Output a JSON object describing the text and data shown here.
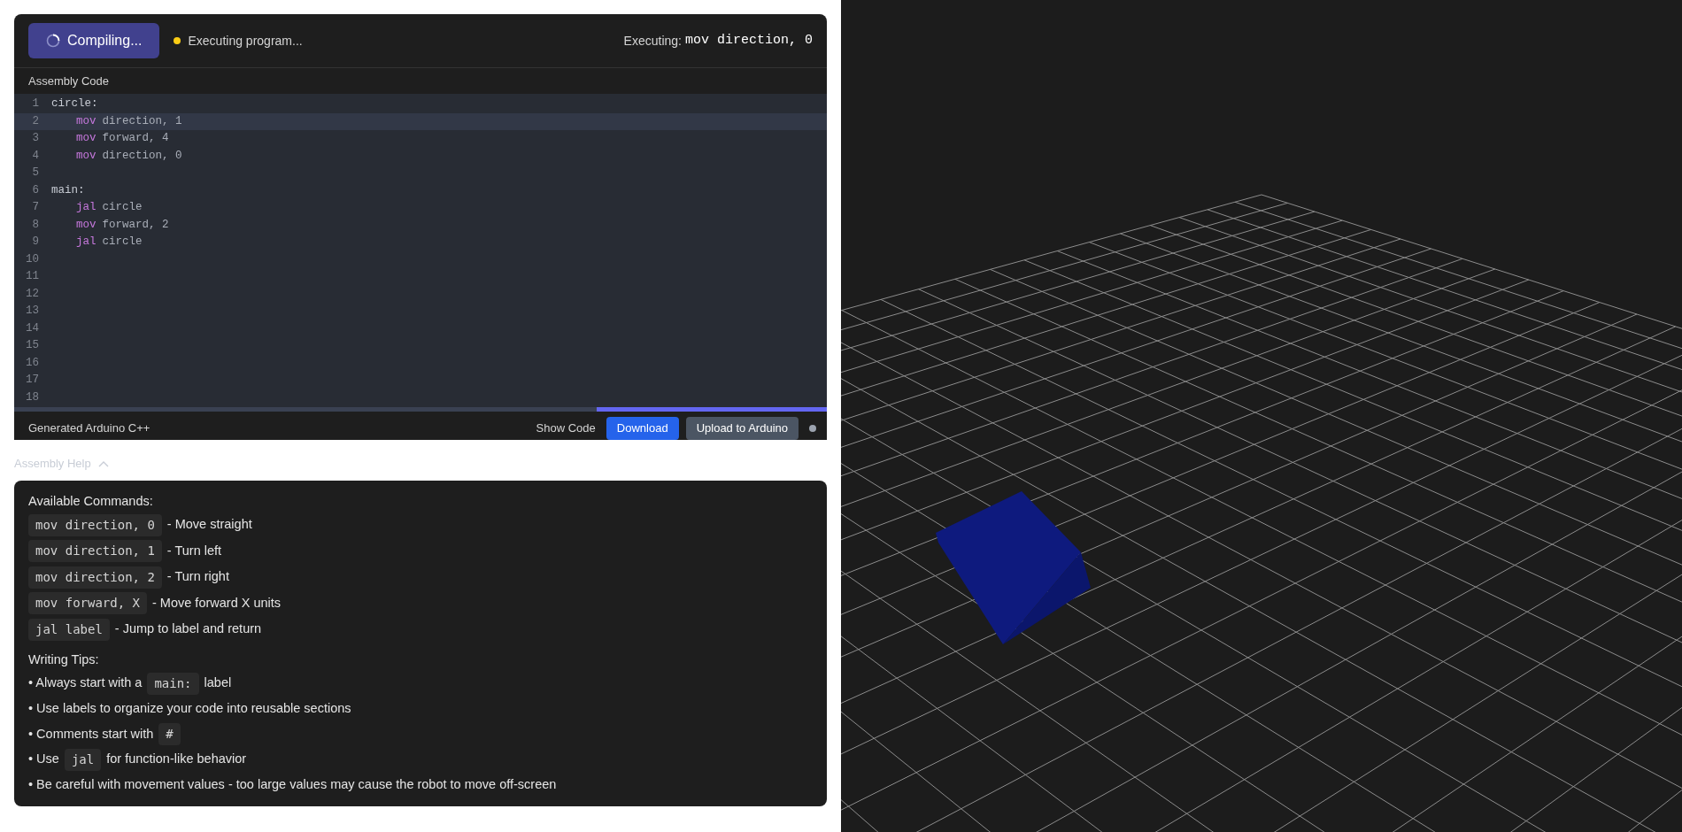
{
  "toolbar": {
    "compile_button": {
      "label": "Compiling...",
      "busy": true
    },
    "status": {
      "text": "Executing program...",
      "color": "#facc15"
    },
    "executing": {
      "label": "Executing:",
      "instruction": "mov direction, 0"
    }
  },
  "editor": {
    "title": "Assembly Code",
    "lines": [
      {
        "num": "1",
        "label": "circle:",
        "highlighted": false
      },
      {
        "num": "2",
        "op": "mov",
        "args": "direction, 1",
        "highlighted": true
      },
      {
        "num": "3",
        "op": "mov",
        "args": "forward, 4",
        "highlighted": false
      },
      {
        "num": "4",
        "op": "mov",
        "args": "direction, 0",
        "highlighted": false
      },
      {
        "num": "5",
        "highlighted": false
      },
      {
        "num": "6",
        "label": "main:",
        "highlighted": false
      },
      {
        "num": "7",
        "op": "jal",
        "args": "circle",
        "highlighted": false
      },
      {
        "num": "8",
        "op": "mov",
        "args": "forward, 2",
        "highlighted": false
      },
      {
        "num": "9",
        "op": "jal",
        "args": "circle",
        "highlighted": false
      },
      {
        "num": "10",
        "highlighted": false
      },
      {
        "num": "11",
        "highlighted": false
      },
      {
        "num": "12",
        "highlighted": false
      },
      {
        "num": "13",
        "highlighted": false
      },
      {
        "num": "14",
        "highlighted": false
      },
      {
        "num": "15",
        "highlighted": false
      },
      {
        "num": "16",
        "highlighted": false
      },
      {
        "num": "17",
        "highlighted": false
      },
      {
        "num": "18",
        "highlighted": false
      }
    ]
  },
  "generated": {
    "title": "Generated Arduino C++",
    "show_code": "Show Code",
    "download": "Download",
    "upload": "Upload to Arduino",
    "connected": false
  },
  "help": {
    "title": "Assembly Help",
    "expanded": true,
    "commands_title": "Available Commands:",
    "commands": [
      {
        "code": "mov direction, 0",
        "desc": "- Move straight"
      },
      {
        "code": "mov direction, 1",
        "desc": "- Turn left"
      },
      {
        "code": "mov direction, 2",
        "desc": "- Turn right"
      },
      {
        "code": "mov forward, X",
        "desc": "- Move forward X units"
      },
      {
        "code": "jal label",
        "desc": "- Jump to label and return"
      }
    ],
    "tips_title": "Writing Tips:",
    "tips": [
      {
        "parts": [
          {
            "kind": "text",
            "text": "• Always start with a"
          },
          {
            "kind": "code",
            "text": "main:"
          },
          {
            "kind": "text",
            "text": "label"
          }
        ]
      },
      {
        "parts": [
          {
            "kind": "text",
            "text": "• Use labels to organize your code into reusable sections"
          }
        ]
      },
      {
        "parts": [
          {
            "kind": "text",
            "text": "• Comments start with"
          },
          {
            "kind": "code",
            "text": "#"
          }
        ]
      },
      {
        "parts": [
          {
            "kind": "text",
            "text": "• Use"
          },
          {
            "kind": "code",
            "text": "jal"
          },
          {
            "kind": "text",
            "text": "for function-like behavior"
          }
        ]
      },
      {
        "parts": [
          {
            "kind": "text",
            "text": "• Be careful with movement values - too large values may cause the robot to move off-screen"
          }
        ]
      }
    ]
  }
}
